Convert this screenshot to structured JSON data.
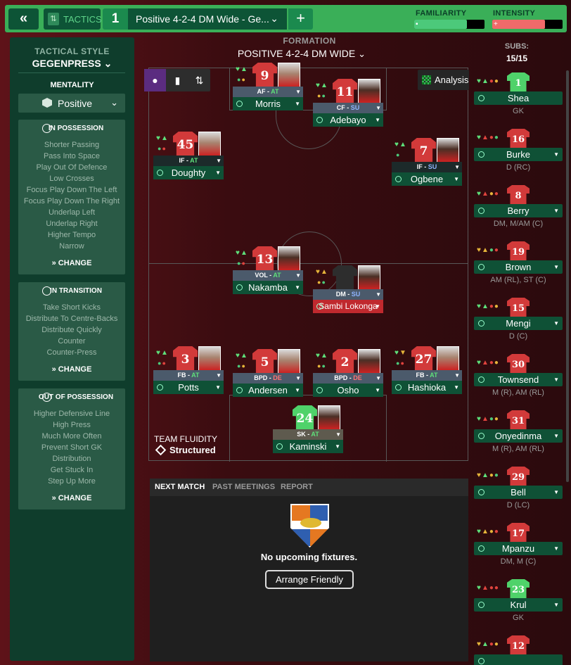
{
  "topbar": {
    "back_icon": "«",
    "tactics_label": "TACTICS",
    "slot_number": "1",
    "tactic_name": "Positive 4-2-4 DM Wide - Ge...",
    "add_label": "+",
    "familiarity_label": "FAMILIARITY",
    "familiarity_level": 0.75,
    "intensity_label": "INTENSITY",
    "intensity_level": 0.75,
    "accent": "#3aaf58"
  },
  "sidebar": {
    "style_heading": "TACTICAL STYLE",
    "style_value": "GEGENPRESS",
    "mentality_heading": "MENTALITY",
    "mentality_value": "Positive",
    "in_possession": {
      "title": "IN POSSESSION",
      "items": [
        "Shorter Passing",
        "Pass Into Space",
        "Play Out Of Defence",
        "Low Crosses",
        "Focus Play Down The Left",
        "Focus Play Down The Right",
        "Underlap Left",
        "Underlap Right",
        "Higher Tempo",
        "Narrow"
      ],
      "change": "CHANGE"
    },
    "in_transition": {
      "title": "IN TRANSITION",
      "items": [
        "Take Short Kicks",
        "Distribute To Centre-Backs",
        "Distribute Quickly",
        "Counter",
        "Counter-Press"
      ],
      "change": "CHANGE"
    },
    "out_of_possession": {
      "title": "OUT OF POSSESSION",
      "items": [
        "Higher Defensive Line",
        "High Press",
        "Much More Often",
        "Prevent Short GK",
        "Distribution",
        "Get Stuck In",
        "Step Up More"
      ],
      "change": "CHANGE"
    }
  },
  "formation": {
    "heading": "FORMATION",
    "value": "POSITIVE 4-2-4 DM WIDE",
    "analysis": "Analysis"
  },
  "players": [
    {
      "number": "9",
      "role": "AF",
      "duty": "AT",
      "name": "Morris"
    },
    {
      "number": "11",
      "role": "CF",
      "duty": "SU",
      "name": "Adebayo"
    },
    {
      "number": "45",
      "role": "IF",
      "duty": "AT",
      "name": "Doughty"
    },
    {
      "number": "7",
      "role": "IF",
      "duty": "SU",
      "name": "Ogbene"
    },
    {
      "number": "13",
      "role": "VOL",
      "duty": "AT",
      "name": "Nakamba"
    },
    {
      "number": "",
      "role": "DM",
      "duty": "SU",
      "name": "Sambi Lokonga"
    },
    {
      "number": "3",
      "role": "FB",
      "duty": "AT",
      "name": "Potts"
    },
    {
      "number": "5",
      "role": "BPD",
      "duty": "DE",
      "name": "Andersen"
    },
    {
      "number": "2",
      "role": "BPD",
      "duty": "DE",
      "name": "Osho"
    },
    {
      "number": "27",
      "role": "FB",
      "duty": "AT",
      "name": "Hashioka"
    },
    {
      "number": "24",
      "role": "SK",
      "duty": "AT",
      "name": "Kaminski"
    }
  ],
  "fluidity": {
    "heading": "TEAM FLUIDITY",
    "value": "Structured"
  },
  "next_match": {
    "tabs": [
      "NEXT MATCH",
      "PAST MEETINGS",
      "REPORT"
    ],
    "message": "No upcoming fixtures.",
    "button": "Arrange Friendly"
  },
  "subs": {
    "heading": "SUBS:",
    "count": "15/15",
    "players": [
      {
        "number": "1",
        "name": "Shea",
        "pos": "GK"
      },
      {
        "number": "16",
        "name": "Burke",
        "pos": "D (RC)"
      },
      {
        "number": "8",
        "name": "Berry",
        "pos": "DM, M/AM (C)"
      },
      {
        "number": "19",
        "name": "Brown",
        "pos": "AM (RL), ST (C)"
      },
      {
        "number": "15",
        "name": "Mengi",
        "pos": "D (C)"
      },
      {
        "number": "30",
        "name": "Townsend",
        "pos": "M (R), AM (RL)"
      },
      {
        "number": "31",
        "name": "Onyedinma",
        "pos": "M (R), AM (RL)"
      },
      {
        "number": "29",
        "name": "Bell",
        "pos": "D (LC)"
      },
      {
        "number": "17",
        "name": "Mpanzu",
        "pos": "DM, M (C)"
      },
      {
        "number": "23",
        "name": "Krul",
        "pos": "GK"
      },
      {
        "number": "12",
        "name": "",
        "pos": ""
      }
    ]
  }
}
